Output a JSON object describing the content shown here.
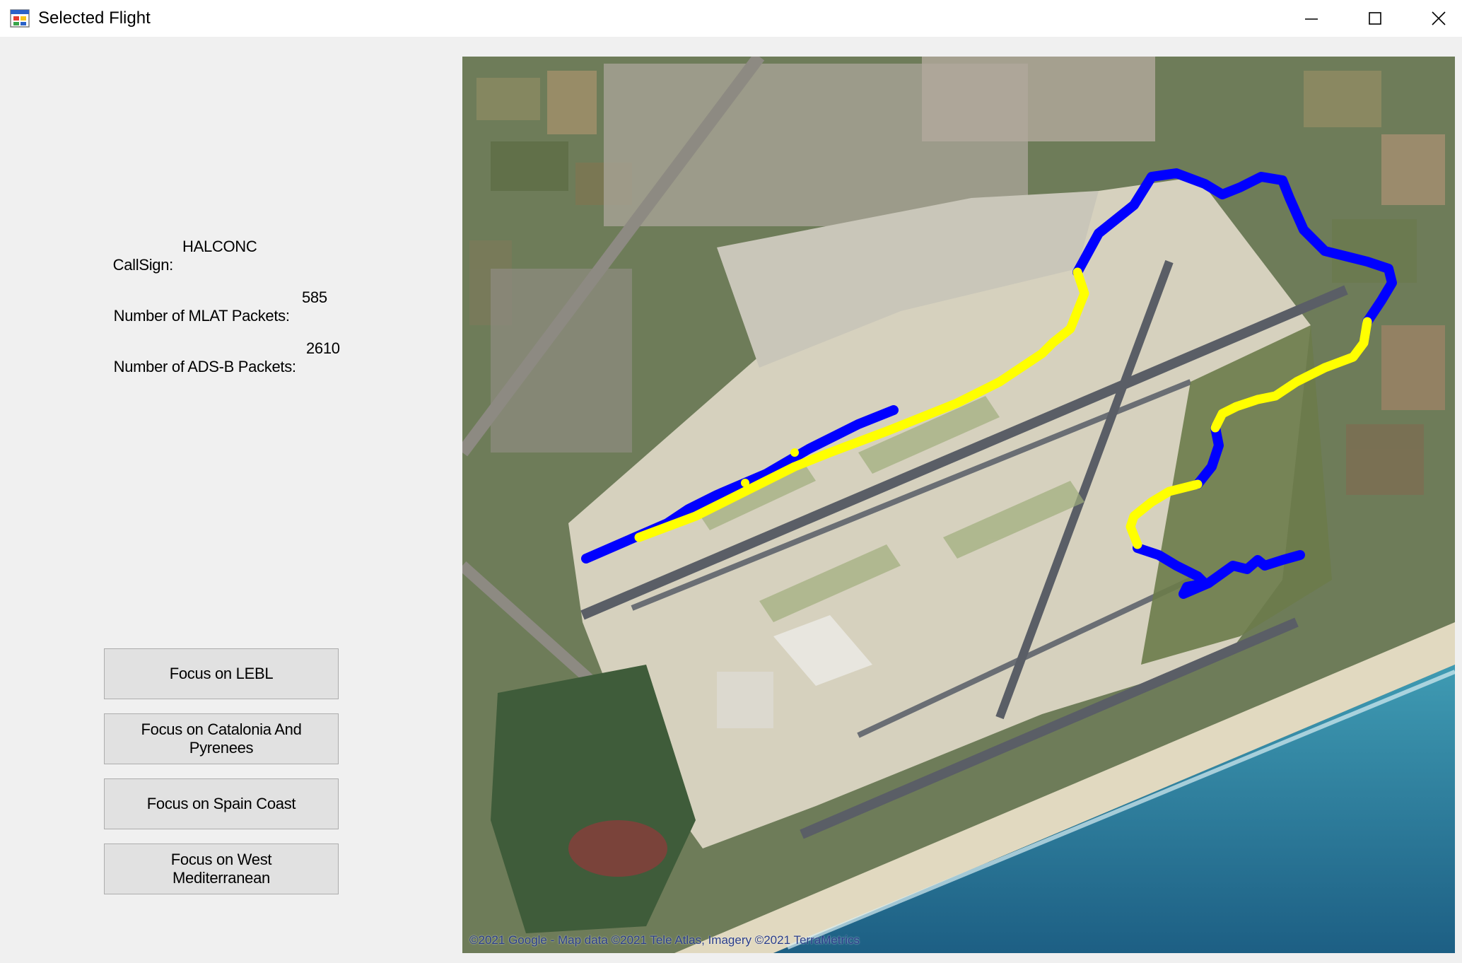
{
  "window": {
    "title": "Selected Flight",
    "icon": "app-window-icon",
    "controls": [
      "minimize-icon",
      "maximize-icon",
      "close-icon"
    ]
  },
  "flight": {
    "callsign_label": "CallSign:",
    "callsign_value": "HALCONC",
    "mlat_label": "Number of MLAT Packets:",
    "mlat_value": "585",
    "adsb_label": "Number of ADS-B Packets:",
    "adsb_value": "2610"
  },
  "buttons": {
    "lebl": "Focus on LEBL",
    "catalonia": "Focus on Catalonia And Pyrenees",
    "spain_coast": "Focus on Spain Coast",
    "west_med": "Focus on West Mediterranean"
  },
  "map": {
    "attribution": "©2021 Google - Map data ©2021 Tele Atlas, Imagery ©2021 TerraMetrics",
    "track_colors": {
      "adsb": "#0000ff",
      "mlat": "#ffff00"
    }
  }
}
